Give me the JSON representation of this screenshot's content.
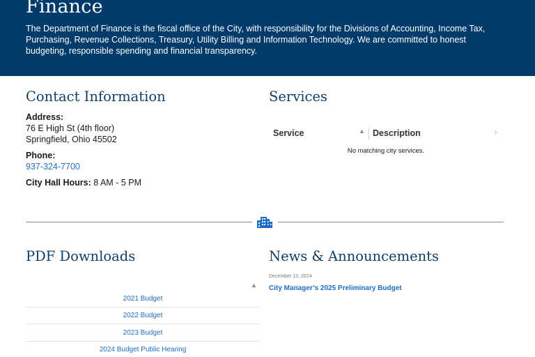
{
  "hero": {
    "title": "Finance",
    "description": "The Department of Finance is the fiscal office of the City, with responsibility for the Divisions of Accounting, Income Tax, Purchasing, Revenue Collections, Treasury, Utility Billing and Information Technology. We are committed to honest budgeting, responsible spending and financial transparency."
  },
  "contact": {
    "heading": "Contact Information",
    "address_label": "Address:",
    "address_line1": "76 E High St (4th floor)",
    "address_line2": "Springfield, Ohio 45502",
    "phone_label": "Phone:",
    "phone": "937-324-7700",
    "hours_label": "City Hall Hours:",
    "hours_value": " 8 AM - 5 PM"
  },
  "services": {
    "heading": "Services",
    "col_service": "Service",
    "col_description": "Description",
    "empty_text": "No matching city services.",
    "sort_icon": "triangle-up-icon",
    "expand_icon": "plus-icon"
  },
  "divider": {
    "icon": "city-buildings-icon",
    "color": "#1f6fc4"
  },
  "pdf": {
    "heading": "PDF Downloads",
    "items": [
      "2021 Budget",
      "2022 Budget",
      "2023 Budget",
      "2024 Budget Public Hearing"
    ]
  },
  "news": {
    "heading": "News & Announcements",
    "items": [
      {
        "date": "December 13, 2024",
        "title": "City Manager’s 2025 Preliminary Budget"
      }
    ]
  },
  "colors": {
    "hero_bg": "#003b6b",
    "heading": "#123e64",
    "link": "#1f6fc4"
  }
}
